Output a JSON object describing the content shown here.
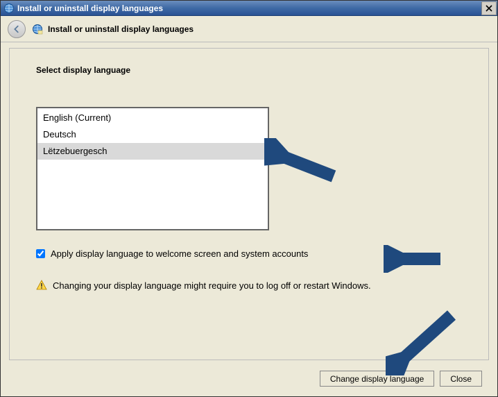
{
  "titlebar": {
    "text": "Install or uninstall display languages"
  },
  "header": {
    "text": "Install or uninstall display languages"
  },
  "content": {
    "section_title": "Select display language",
    "languages": [
      {
        "label": "English (Current)",
        "selected": false
      },
      {
        "label": "Deutsch",
        "selected": false
      },
      {
        "label": "Lëtzebuergesch",
        "selected": true
      }
    ],
    "checkbox": {
      "checked": true,
      "label": "Apply display language to welcome screen and system accounts"
    },
    "warning": {
      "text": "Changing your display language might require you to log off or restart Windows."
    }
  },
  "buttons": {
    "primary": "Change display language",
    "close": "Close"
  },
  "annotation": {
    "arrow_color": "#1f497d"
  }
}
